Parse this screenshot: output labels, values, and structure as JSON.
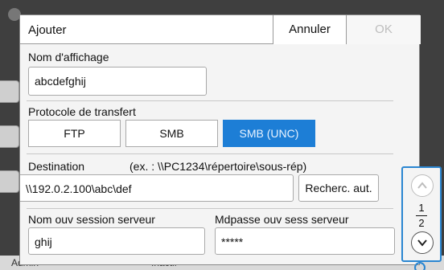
{
  "dialog": {
    "title": "Ajouter",
    "cancel_label": "Annuler",
    "ok_label": "OK"
  },
  "display_name": {
    "label": "Nom d'affichage",
    "value": "abcdefghij"
  },
  "protocol": {
    "label": "Protocole de transfert",
    "options": [
      "FTP",
      "SMB",
      "SMB (UNC)"
    ],
    "selected": "SMB (UNC)"
  },
  "destination": {
    "label": "Destination",
    "example": "(ex. : \\\\PC1234\\répertoire\\sous-rép)",
    "value": "\\\\192.0.2.100\\abc\\def",
    "search_label": "Recherc. aut."
  },
  "server_login": {
    "label": "Nom ouv session serveur",
    "value": "ghij"
  },
  "server_password": {
    "label": "Mdpasse ouv sess serveur",
    "value": "*****"
  },
  "pager": {
    "current": "1",
    "total": "2"
  },
  "background": {
    "user": "Admin",
    "status": "Inactif"
  },
  "colors": {
    "accent": "#1d7ed6",
    "pager_highlight": "#2a86d1"
  }
}
